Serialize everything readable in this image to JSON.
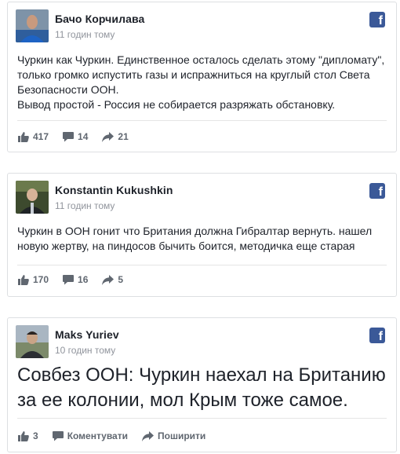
{
  "posts": [
    {
      "author": "Бачо Корчилава",
      "time": "11 годин тому",
      "text": "Чуркин как Чуркин. Единственное осталось сделать этому \"дипломату\", только громко испустить газы и испражниться на круглый стол Света Безопасности ООН.\nВывод простой - Россия не собирается разряжать обстановку.",
      "likes": "417",
      "comments": "14",
      "shares": "21"
    },
    {
      "author": "Konstantin Kukushkin",
      "time": "11 годин тому",
      "text": "Чуркин в ООН гонит что Британия должна Гибралтар вернуть. нашел новую жертву, на пиндосов бычить боится, методичка еще старая",
      "likes": "170",
      "comments": "16",
      "shares": "5"
    },
    {
      "author": "Maks Yuriev",
      "time": "10 годин тому",
      "text": "Совбез ООН: Чуркин наехал на Британию за ее колонии, мол Крым тоже самое.",
      "likes": "3",
      "comment_label": "Коментувати",
      "share_label": "Поширити"
    }
  ],
  "icons": {
    "brand": "facebook-icon",
    "like": "thumbs-up-icon",
    "comment": "comment-bubble-icon",
    "share": "share-arrow-icon"
  },
  "colors": {
    "facebook_blue": "#3b5998",
    "meta_gray": "#90949c",
    "action_gray": "#606770"
  }
}
